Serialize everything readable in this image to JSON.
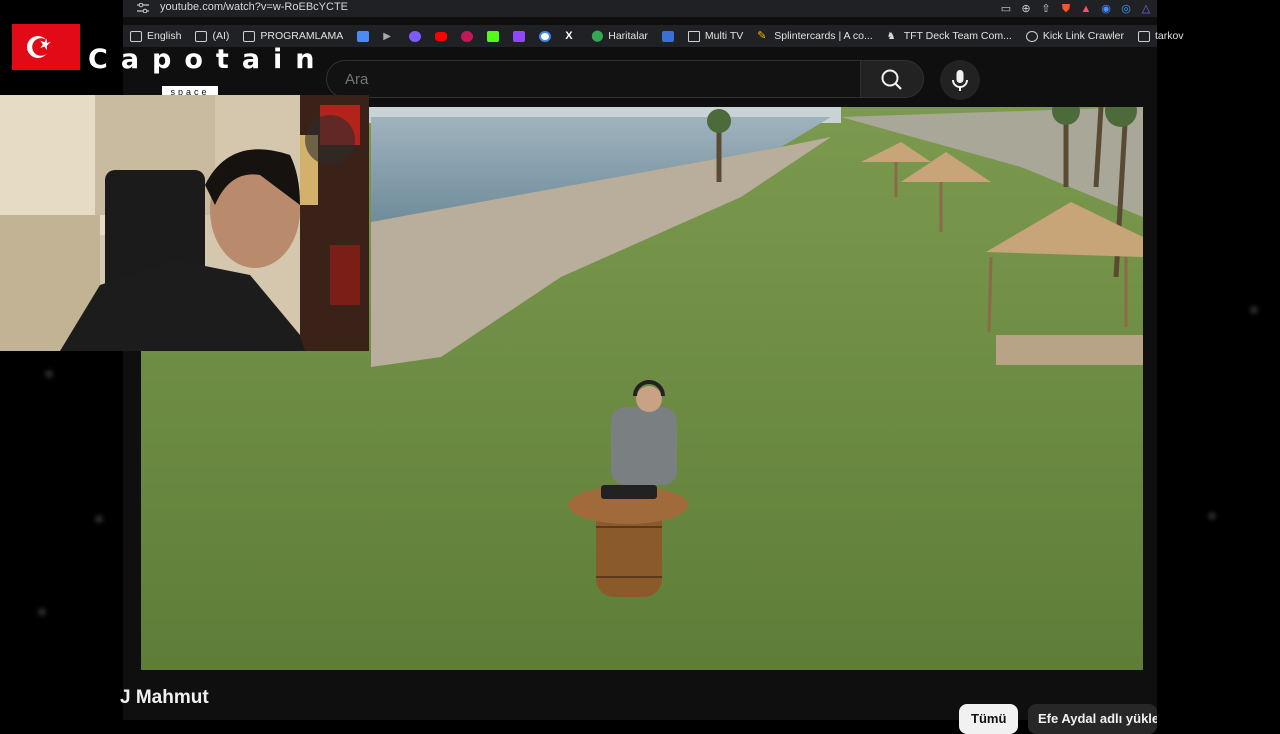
{
  "browser": {
    "url": "youtube.com/watch?v=w-RoEBcYCTE",
    "bookmarks": [
      {
        "label": "English",
        "icon": "folder-icon"
      },
      {
        "label": "(AI)",
        "icon": "folder-icon"
      },
      {
        "label": "PROGRAMLAMA",
        "icon": "folder-icon"
      },
      {
        "label": "",
        "icon": "translate-icon"
      },
      {
        "label": "",
        "icon": "prime-icon"
      },
      {
        "label": "",
        "icon": "app-icon"
      },
      {
        "label": "",
        "icon": "youtube-icon"
      },
      {
        "label": "",
        "icon": "app-icon"
      },
      {
        "label": "",
        "icon": "kick-icon"
      },
      {
        "label": "",
        "icon": "twitch-icon"
      },
      {
        "label": "",
        "icon": "google-icon"
      },
      {
        "label": "",
        "icon": "x-icon"
      },
      {
        "label": "Haritalar",
        "icon": "maps-icon"
      },
      {
        "label": "",
        "icon": "app-icon"
      },
      {
        "label": "Multi TV",
        "icon": "tv-icon"
      },
      {
        "label": "Splintercards | A co...",
        "icon": "card-icon"
      },
      {
        "label": "TFT Deck Team Com...",
        "icon": "tft-icon"
      },
      {
        "label": "Kick Link Crawler",
        "icon": "globe-icon"
      },
      {
        "label": "tarkov",
        "icon": "folder-icon"
      }
    ]
  },
  "youtube": {
    "search_placeholder": "Ara",
    "video_title": "J Mahmut",
    "chips": {
      "all": "Tümü",
      "channel": "Efe Aydal adlı yükleyiciden"
    }
  },
  "overlay": {
    "brand": "Capotain",
    "brand_sub": "space"
  },
  "colors": {
    "flag_red": "#e30a17",
    "browser_bg": "#202124",
    "yt_bg": "#0f0f0f"
  }
}
